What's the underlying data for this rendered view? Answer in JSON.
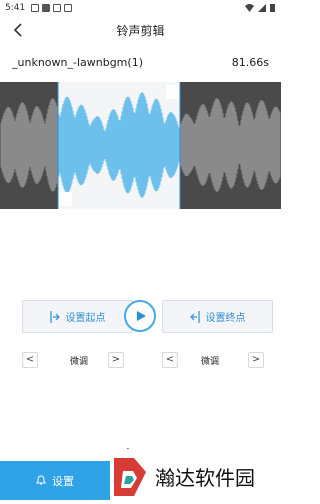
{
  "status_bar": {
    "time": "5:41"
  },
  "header": {
    "title": "铃声剪辑"
  },
  "file": {
    "name": "_unknown_-lawnbgm(1)",
    "duration": "81.66s"
  },
  "controls": {
    "set_start_label": "设置起点",
    "set_end_label": "设置终点",
    "fine_left_label": "微调",
    "fine_right_label": "微调",
    "prev_symbol": "<",
    "next_symbol": ">"
  },
  "bottom": {
    "set_label": "设置"
  },
  "watermark": {
    "text": "瀚达软件园"
  },
  "colors": {
    "accent": "#2fa3e6",
    "wave_selected": "#4db3ea",
    "wave_unselected": "#9a9a9a"
  },
  "icons": [
    "back-arrow-icon",
    "play-icon",
    "bell-icon",
    "start-marker-icon",
    "end-marker-icon"
  ]
}
